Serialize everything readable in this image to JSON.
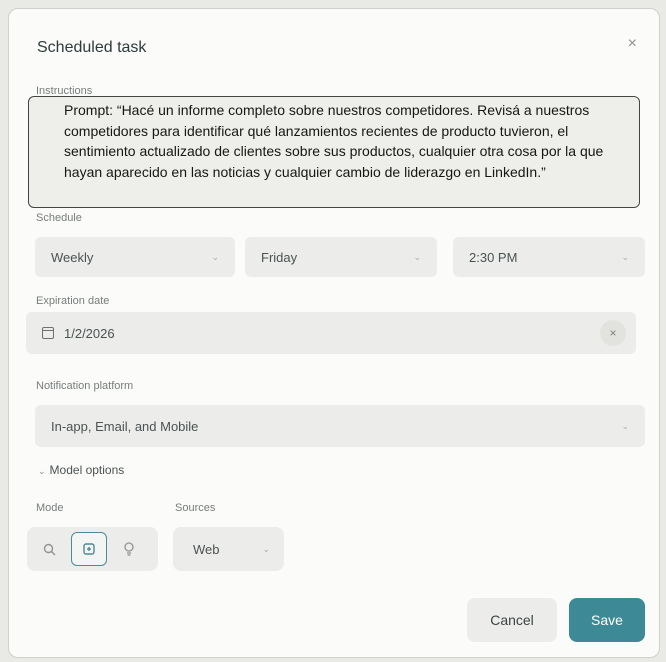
{
  "dialog": {
    "title": "Scheduled task",
    "close_icon": "×"
  },
  "instructions": {
    "label": "Instructions",
    "text": "Prompt: “Hacé un informe completo sobre nuestros competidores. Revisá a nuestros competidores para identificar qué lanzamientos recientes de producto tuvieron, el sentimiento actualizado de clientes sobre sus productos, cualquier otra cosa por la que hayan aparecido en las noticias y cualquier cambio de liderazgo en LinkedIn.”"
  },
  "schedule": {
    "label": "Schedule",
    "frequency": "Weekly",
    "day": "Friday",
    "time": "2:30 PM"
  },
  "expiration": {
    "label": "Expiration date",
    "value": "1/2/2026"
  },
  "notification": {
    "label": "Notification platform",
    "value": "In-app, Email, and Mobile"
  },
  "model_options": {
    "toggle_label": "Model options",
    "mode_label": "Mode",
    "mode_icons": [
      "search-icon",
      "compass-icon",
      "lightbulb-icon"
    ],
    "mode_active": "compass-icon",
    "sources_label": "Sources",
    "sources_value": "Web"
  },
  "actions": {
    "cancel": "Cancel",
    "save": "Save"
  },
  "colors": {
    "accent": "#3d8a96",
    "field_bg": "#ececea",
    "dialog_bg": "#fbfbf9"
  }
}
